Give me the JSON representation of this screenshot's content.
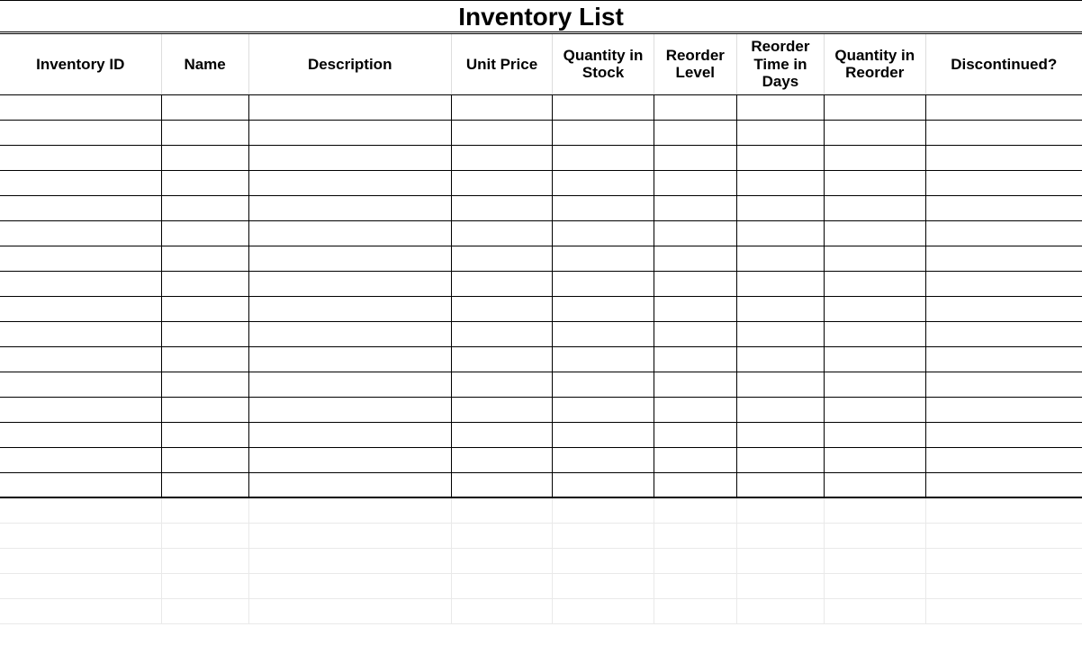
{
  "title": "Inventory List",
  "columns": [
    "Inventory ID",
    "Name",
    "Description",
    "Unit Price",
    "Quantity in Stock",
    "Reorder Level",
    "Reorder Time in Days",
    "Quantity in Reorder",
    "Discontinued?"
  ],
  "rows": [
    [
      "",
      "",
      "",
      "",
      "",
      "",
      "",
      "",
      ""
    ],
    [
      "",
      "",
      "",
      "",
      "",
      "",
      "",
      "",
      ""
    ],
    [
      "",
      "",
      "",
      "",
      "",
      "",
      "",
      "",
      ""
    ],
    [
      "",
      "",
      "",
      "",
      "",
      "",
      "",
      "",
      ""
    ],
    [
      "",
      "",
      "",
      "",
      "",
      "",
      "",
      "",
      ""
    ],
    [
      "",
      "",
      "",
      "",
      "",
      "",
      "",
      "",
      ""
    ],
    [
      "",
      "",
      "",
      "",
      "",
      "",
      "",
      "",
      ""
    ],
    [
      "",
      "",
      "",
      "",
      "",
      "",
      "",
      "",
      ""
    ],
    [
      "",
      "",
      "",
      "",
      "",
      "",
      "",
      "",
      ""
    ],
    [
      "",
      "",
      "",
      "",
      "",
      "",
      "",
      "",
      ""
    ],
    [
      "",
      "",
      "",
      "",
      "",
      "",
      "",
      "",
      ""
    ],
    [
      "",
      "",
      "",
      "",
      "",
      "",
      "",
      "",
      ""
    ],
    [
      "",
      "",
      "",
      "",
      "",
      "",
      "",
      "",
      ""
    ],
    [
      "",
      "",
      "",
      "",
      "",
      "",
      "",
      "",
      ""
    ],
    [
      "",
      "",
      "",
      "",
      "",
      "",
      "",
      "",
      ""
    ],
    [
      "",
      "",
      "",
      "",
      "",
      "",
      "",
      "",
      ""
    ]
  ],
  "blank_trailing_rows": 5
}
